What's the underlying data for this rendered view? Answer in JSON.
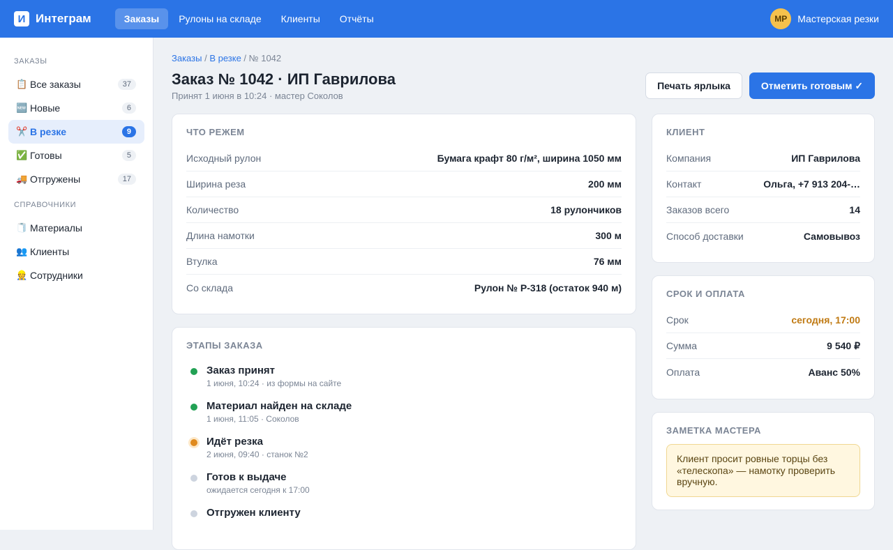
{
  "app": {
    "logo_letter": "И",
    "name": "Интеграм"
  },
  "nav": [
    {
      "label": "Заказы",
      "active": true
    },
    {
      "label": "Рулоны на складе"
    },
    {
      "label": "Клиенты"
    },
    {
      "label": "Отчёты"
    }
  ],
  "user": {
    "initials": "МР",
    "name": "Мастерская резки"
  },
  "sidebar": {
    "orders_heading": "Заказы",
    "items": [
      {
        "icon": "📋",
        "label": "Все заказы",
        "count": "37"
      },
      {
        "icon": "🆕",
        "label": "Новые",
        "count": "6"
      },
      {
        "icon": "✂️",
        "label": "В резке",
        "count": "9",
        "active": true
      },
      {
        "icon": "✅",
        "label": "Готовы",
        "count": "5"
      },
      {
        "icon": "🚚",
        "label": "Отгружены",
        "count": "17"
      }
    ],
    "refs_heading": "Справочники",
    "refs": [
      {
        "icon": "🧻",
        "label": "Материалы"
      },
      {
        "icon": "👥",
        "label": "Клиенты"
      },
      {
        "icon": "👷",
        "label": "Сотрудники"
      }
    ]
  },
  "breadcrumb": {
    "root": "Заказы",
    "section": "В резке",
    "current": "№ 1042"
  },
  "order": {
    "title": "Заказ № 1042 · ИП Гаврилова",
    "subtitle": "Принят 1 июня в 10:24 · мастер Соколов"
  },
  "actions": {
    "print": "Печать ярлыка",
    "done": "Отметить готовым ✓"
  },
  "cut": {
    "title": "Что режем",
    "rows": [
      {
        "k": "Исходный рулон",
        "v": "Бумага крафт 80 г/м², ширина 1050 мм"
      },
      {
        "k": "Ширина реза",
        "v": "200 мм"
      },
      {
        "k": "Количество",
        "v": "18 рулончиков"
      },
      {
        "k": "Длина намотки",
        "v": "300 м"
      },
      {
        "k": "Втулка",
        "v": "76 мм"
      },
      {
        "k": "Со склада",
        "v": "Рулон № Р-318 (остаток 940 м)"
      }
    ]
  },
  "client": {
    "title": "Клиент",
    "rows": [
      {
        "k": "Компания",
        "v": "ИП Гаврилова"
      },
      {
        "k": "Контакт",
        "v": "Ольга, +7 913 204-…"
      },
      {
        "k": "Заказов всего",
        "v": "14"
      },
      {
        "k": "Способ доставки",
        "v": "Самовывоз"
      }
    ]
  },
  "term": {
    "title": "Срок и оплата",
    "rows": [
      {
        "k": "Срок",
        "v": "сегодня, 17:00"
      },
      {
        "k": "Сумма",
        "v": "9 540 ₽"
      },
      {
        "k": "Оплата",
        "v": "Аванс 50%"
      }
    ],
    "deadline_color": "#c07a13"
  },
  "note": {
    "title": "Заметка мастера",
    "text": "Клиент просит ровные торцы без «телескопа» — намотку проверить вручную."
  },
  "stages": {
    "title": "Этапы заказа",
    "items": [
      {
        "name": "Заказ принят",
        "meta": "1 июня, 10:24 · из формы на сайте",
        "state": "done"
      },
      {
        "name": "Материал найден на складе",
        "meta": "1 июня, 11:05 · Соколов",
        "state": "done"
      },
      {
        "name": "Идёт резка",
        "meta": "2 июня, 09:40 · станок №2",
        "state": "current"
      },
      {
        "name": "Готов к выдаче",
        "meta": "ожидается сегодня к 17:00",
        "state": "pending"
      },
      {
        "name": "Отгружен клиенту",
        "meta": "",
        "state": "pending"
      }
    ]
  },
  "colors": {
    "accent": "#2b74e6",
    "done": "#22a154",
    "current": "#e08a1e",
    "pending": "#cdd4df"
  }
}
